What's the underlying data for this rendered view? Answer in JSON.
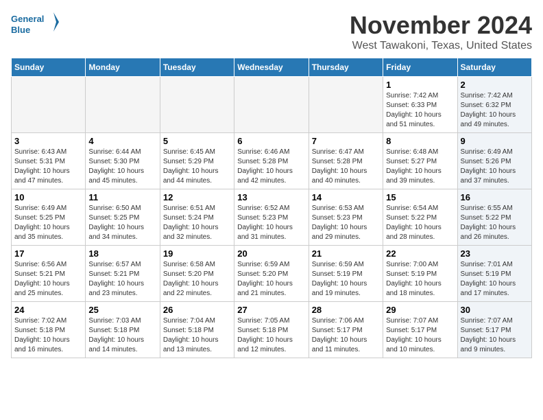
{
  "header": {
    "logo_line1": "General",
    "logo_line2": "Blue",
    "month": "November 2024",
    "location": "West Tawakoni, Texas, United States"
  },
  "weekdays": [
    "Sunday",
    "Monday",
    "Tuesday",
    "Wednesday",
    "Thursday",
    "Friday",
    "Saturday"
  ],
  "weeks": [
    [
      {
        "day": "",
        "info": "",
        "empty": true
      },
      {
        "day": "",
        "info": "",
        "empty": true
      },
      {
        "day": "",
        "info": "",
        "empty": true
      },
      {
        "day": "",
        "info": "",
        "empty": true
      },
      {
        "day": "",
        "info": "",
        "empty": true
      },
      {
        "day": "1",
        "info": "Sunrise: 7:42 AM\nSunset: 6:33 PM\nDaylight: 10 hours\nand 51 minutes.",
        "empty": false,
        "shaded": false
      },
      {
        "day": "2",
        "info": "Sunrise: 7:42 AM\nSunset: 6:32 PM\nDaylight: 10 hours\nand 49 minutes.",
        "empty": false,
        "shaded": true
      }
    ],
    [
      {
        "day": "3",
        "info": "Sunrise: 6:43 AM\nSunset: 5:31 PM\nDaylight: 10 hours\nand 47 minutes.",
        "empty": false,
        "shaded": false
      },
      {
        "day": "4",
        "info": "Sunrise: 6:44 AM\nSunset: 5:30 PM\nDaylight: 10 hours\nand 45 minutes.",
        "empty": false,
        "shaded": false
      },
      {
        "day": "5",
        "info": "Sunrise: 6:45 AM\nSunset: 5:29 PM\nDaylight: 10 hours\nand 44 minutes.",
        "empty": false,
        "shaded": false
      },
      {
        "day": "6",
        "info": "Sunrise: 6:46 AM\nSunset: 5:28 PM\nDaylight: 10 hours\nand 42 minutes.",
        "empty": false,
        "shaded": false
      },
      {
        "day": "7",
        "info": "Sunrise: 6:47 AM\nSunset: 5:28 PM\nDaylight: 10 hours\nand 40 minutes.",
        "empty": false,
        "shaded": false
      },
      {
        "day": "8",
        "info": "Sunrise: 6:48 AM\nSunset: 5:27 PM\nDaylight: 10 hours\nand 39 minutes.",
        "empty": false,
        "shaded": false
      },
      {
        "day": "9",
        "info": "Sunrise: 6:49 AM\nSunset: 5:26 PM\nDaylight: 10 hours\nand 37 minutes.",
        "empty": false,
        "shaded": true
      }
    ],
    [
      {
        "day": "10",
        "info": "Sunrise: 6:49 AM\nSunset: 5:25 PM\nDaylight: 10 hours\nand 35 minutes.",
        "empty": false,
        "shaded": false
      },
      {
        "day": "11",
        "info": "Sunrise: 6:50 AM\nSunset: 5:25 PM\nDaylight: 10 hours\nand 34 minutes.",
        "empty": false,
        "shaded": false
      },
      {
        "day": "12",
        "info": "Sunrise: 6:51 AM\nSunset: 5:24 PM\nDaylight: 10 hours\nand 32 minutes.",
        "empty": false,
        "shaded": false
      },
      {
        "day": "13",
        "info": "Sunrise: 6:52 AM\nSunset: 5:23 PM\nDaylight: 10 hours\nand 31 minutes.",
        "empty": false,
        "shaded": false
      },
      {
        "day": "14",
        "info": "Sunrise: 6:53 AM\nSunset: 5:23 PM\nDaylight: 10 hours\nand 29 minutes.",
        "empty": false,
        "shaded": false
      },
      {
        "day": "15",
        "info": "Sunrise: 6:54 AM\nSunset: 5:22 PM\nDaylight: 10 hours\nand 28 minutes.",
        "empty": false,
        "shaded": false
      },
      {
        "day": "16",
        "info": "Sunrise: 6:55 AM\nSunset: 5:22 PM\nDaylight: 10 hours\nand 26 minutes.",
        "empty": false,
        "shaded": true
      }
    ],
    [
      {
        "day": "17",
        "info": "Sunrise: 6:56 AM\nSunset: 5:21 PM\nDaylight: 10 hours\nand 25 minutes.",
        "empty": false,
        "shaded": false
      },
      {
        "day": "18",
        "info": "Sunrise: 6:57 AM\nSunset: 5:21 PM\nDaylight: 10 hours\nand 23 minutes.",
        "empty": false,
        "shaded": false
      },
      {
        "day": "19",
        "info": "Sunrise: 6:58 AM\nSunset: 5:20 PM\nDaylight: 10 hours\nand 22 minutes.",
        "empty": false,
        "shaded": false
      },
      {
        "day": "20",
        "info": "Sunrise: 6:59 AM\nSunset: 5:20 PM\nDaylight: 10 hours\nand 21 minutes.",
        "empty": false,
        "shaded": false
      },
      {
        "day": "21",
        "info": "Sunrise: 6:59 AM\nSunset: 5:19 PM\nDaylight: 10 hours\nand 19 minutes.",
        "empty": false,
        "shaded": false
      },
      {
        "day": "22",
        "info": "Sunrise: 7:00 AM\nSunset: 5:19 PM\nDaylight: 10 hours\nand 18 minutes.",
        "empty": false,
        "shaded": false
      },
      {
        "day": "23",
        "info": "Sunrise: 7:01 AM\nSunset: 5:19 PM\nDaylight: 10 hours\nand 17 minutes.",
        "empty": false,
        "shaded": true
      }
    ],
    [
      {
        "day": "24",
        "info": "Sunrise: 7:02 AM\nSunset: 5:18 PM\nDaylight: 10 hours\nand 16 minutes.",
        "empty": false,
        "shaded": false
      },
      {
        "day": "25",
        "info": "Sunrise: 7:03 AM\nSunset: 5:18 PM\nDaylight: 10 hours\nand 14 minutes.",
        "empty": false,
        "shaded": false
      },
      {
        "day": "26",
        "info": "Sunrise: 7:04 AM\nSunset: 5:18 PM\nDaylight: 10 hours\nand 13 minutes.",
        "empty": false,
        "shaded": false
      },
      {
        "day": "27",
        "info": "Sunrise: 7:05 AM\nSunset: 5:18 PM\nDaylight: 10 hours\nand 12 minutes.",
        "empty": false,
        "shaded": false
      },
      {
        "day": "28",
        "info": "Sunrise: 7:06 AM\nSunset: 5:17 PM\nDaylight: 10 hours\nand 11 minutes.",
        "empty": false,
        "shaded": false
      },
      {
        "day": "29",
        "info": "Sunrise: 7:07 AM\nSunset: 5:17 PM\nDaylight: 10 hours\nand 10 minutes.",
        "empty": false,
        "shaded": false
      },
      {
        "day": "30",
        "info": "Sunrise: 7:07 AM\nSunset: 5:17 PM\nDaylight: 10 hours\nand 9 minutes.",
        "empty": false,
        "shaded": true
      }
    ]
  ]
}
